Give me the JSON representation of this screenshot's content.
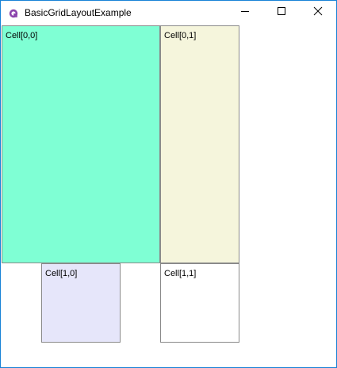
{
  "window": {
    "title": "BasicGridLayoutExample",
    "app_icon": "avalonia-logo-icon",
    "controls": {
      "minimize_icon": "minimize-icon",
      "maximize_icon": "maximize-icon",
      "close_icon": "close-icon"
    }
  },
  "grid": {
    "cells": [
      {
        "label": "Cell[0,0]",
        "color": "#7fffd4"
      },
      {
        "label": "Cell[0,1]",
        "color": "#f5f5dc"
      },
      {
        "label": "Cell[1,0]",
        "color": "#e6e6fa"
      },
      {
        "label": "Cell[1,1]",
        "color": "#ffffff"
      }
    ]
  },
  "colors": {
    "window_border": "#1883d7",
    "cell_border": "#8a8a8a"
  }
}
